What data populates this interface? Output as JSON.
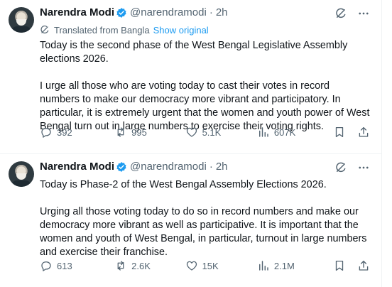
{
  "tweets": [
    {
      "author_name": "Narendra Modi",
      "handle": "@narendramodi",
      "separator": "·",
      "time": "2h",
      "translated_label": "Translated from Bangla",
      "show_original": "Show original",
      "paragraphs": [
        "Today is the second phase of the West Bengal Legislative Assembly elections 2026.",
        "I urge all those who are voting today to cast their votes in record numbers to make our democracy more vibrant and participatory. In particular, it is extremely urgent that the women and youth power of West Bengal turn out in large numbers to exercise their voting rights."
      ],
      "stats": {
        "replies": "392",
        "reposts": "995",
        "likes": "5.1K",
        "views": "607K"
      }
    },
    {
      "author_name": "Narendra Modi",
      "handle": "@narendramodi",
      "separator": "·",
      "time": "2h",
      "paragraphs": [
        "Today is Phase-2 of the West Bengal Assembly Elections 2026.",
        "Urging all those voting today to do so in record numbers and make our democracy more vibrant as well as participative. It is important that the women and youth of West Bengal, in particular, turnout in large numbers and exercise their franchise."
      ],
      "stats": {
        "replies": "613",
        "reposts": "2.6K",
        "likes": "15K",
        "views": "2.1M"
      }
    }
  ],
  "icons": {
    "verified": "verified-badge-icon",
    "grok": "grok-icon",
    "more": "more-icon",
    "translate": "translate-icon",
    "reply": "reply-icon",
    "repost": "repost-icon",
    "like": "heart-icon",
    "views": "views-icon",
    "bookmark": "bookmark-icon",
    "share": "share-icon"
  },
  "colors": {
    "text": "#0f1419",
    "secondary": "#536471",
    "link": "#1d9bf0",
    "verified": "#1d9bf0",
    "divider": "#eff3f4"
  }
}
